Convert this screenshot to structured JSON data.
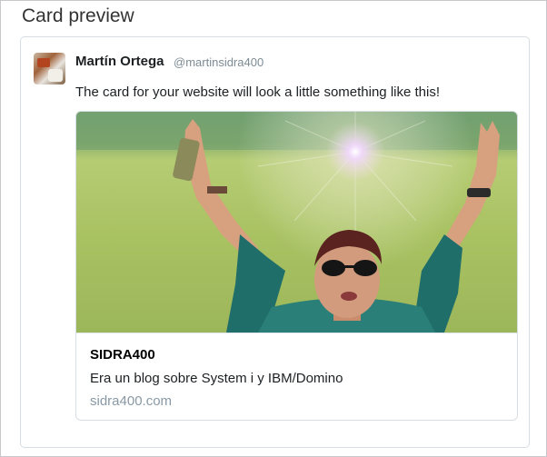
{
  "panel": {
    "title": "Card preview"
  },
  "tweet": {
    "display_name": "Martín Ortega",
    "screen_name": "@martinsidra400",
    "text": "The card for your website will look a little something like this!"
  },
  "card": {
    "image_icon": "photo-of-woman-with-raised-arms",
    "title": "SIDRA400",
    "description": "Era un blog sobre System i y IBM/Domino",
    "domain": "sidra400.com"
  }
}
